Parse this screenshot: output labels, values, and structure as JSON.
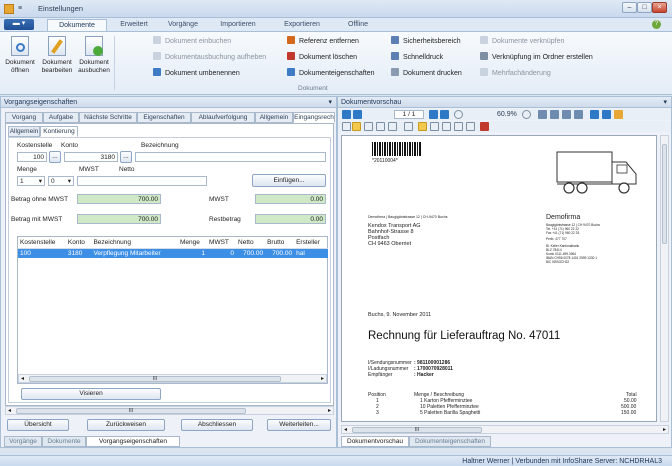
{
  "window": {
    "title": "Einstellungen",
    "min": "–",
    "max": "□",
    "close": "×"
  },
  "ribbon": {
    "file_button": "▬ ▾",
    "tabs": [
      "Dokumente",
      "Erweitert",
      "Vorgänge",
      "Importieren",
      "Exportieren",
      "Offline"
    ],
    "help": "?",
    "big": [
      {
        "label": "Dokument öffnen"
      },
      {
        "label": "Dokument bearbeiten"
      },
      {
        "label": "Dokument ausbuchen"
      }
    ],
    "col1": [
      "Dokument einbuchen",
      "Dokumentausbuchung aufheben",
      "Dokument umbenennen"
    ],
    "col2": [
      "Referenz entfernen",
      "Dokument löschen",
      "Dokumenteigenschaften"
    ],
    "col3": [
      "Sicherheitsbereich",
      "Schnelldruck",
      "Dokument drucken"
    ],
    "col4": [
      "Dokumente verknüpfen",
      "Verknüpfung im Ordner erstellen",
      "Mehrfachänderung"
    ],
    "group_label": "Dokument"
  },
  "left": {
    "header": "Vorgangseigenschaften",
    "tabs": [
      "Vorgang",
      "Aufgabe",
      "Nächste Schritte",
      "Eigenschaften",
      "Ablaufverfolgung",
      "Allgemein",
      "Eingangsrech"
    ],
    "subtabs": [
      "Allgemein",
      "Kontierung"
    ],
    "labels": {
      "kostenstelle": "Kostenstelle",
      "konto": "Konto",
      "bezeichnung": "Bezeichnung",
      "menge": "Menge",
      "mwst": "MWST",
      "netto": "Netto",
      "betrag_ohne": "Betrag ohne MWST",
      "mwst2": "MWST",
      "betrag_mit": "Betrag mit MWST",
      "restbetrag": "Restbetrag"
    },
    "values": {
      "kostenstelle": "100",
      "konto": "3180",
      "bezeichnung": "",
      "menge": "1",
      "mwst": "0",
      "netto": "",
      "betrag_ohne": "700.00",
      "mwst2": "0.00",
      "betrag_mit": "700.00",
      "restbetrag": "0.00"
    },
    "dots": "...",
    "einfuegen": "Einfügen...",
    "table": {
      "columns": [
        "Kostenstelle",
        "Konto",
        "Bezeichnung",
        "Menge",
        "MWST",
        "Netto",
        "Brutto",
        "Ersteller"
      ],
      "rows": [
        [
          "100",
          "3180",
          "Verpflegung Mitarbeiter",
          "1",
          "0",
          "700.00",
          "700.00",
          "hal"
        ]
      ]
    },
    "scroll_mid": "III",
    "visieren": "Visieren",
    "buttons": [
      "Übersicht",
      "Zurückweisen",
      "Abschliessen",
      "Weiterleiten..."
    ],
    "bottom_tabs": [
      "Vorgänge",
      "Dokumente",
      "Vorgangseigenschaften"
    ]
  },
  "right": {
    "header": "Dokumentvorschau",
    "page_field": "1 / 1",
    "zoom": "60.9%",
    "doc": {
      "barcode_text": "*20110004*",
      "sender_line": "Demofirma | Baugigäntstrasse 12 | CH-9470 Buchs",
      "address": [
        "Kendox Transport AG",
        "Bahnhof-Strasse 8",
        "Postfach",
        "CH 9463 Oberriet"
      ],
      "company": "Demofirma",
      "company_lines": [
        "Baugigäntstrasse 12 | CH 9470 Buchs",
        "Tel. +41 (71) 960 22 22",
        "Fax +41 (71) 960 22 25",
        "Perib. 477 707",
        "Bl. Keller Kantonalbank",
        "BLZ 78414",
        "Konto 0111.499.3964",
        "IBAN CH96 0078 1401 2599 1330 1",
        "BIC KBSGCH22"
      ],
      "date_line": "Buchs, 9. November 2011",
      "title": "Rechnung für Lieferauftrag No. 47011",
      "refs": [
        [
          "I/Sendungsnummer",
          ": 981100001286"
        ],
        [
          "I/Ladungsnummer",
          ": 1700070928011"
        ],
        [
          "Empfänger",
          ": Hacker"
        ]
      ],
      "items_head": [
        "Position",
        "Menge / Beschreibung",
        "Total"
      ],
      "items": [
        [
          "1",
          "1 Karton Pfefferminztee",
          "50.00"
        ],
        [
          "2",
          "10 Paletten Pfefferminztee",
          "500.00"
        ],
        [
          "3",
          "5 Paletten Barilla Spaghetti",
          "150.00"
        ]
      ]
    },
    "scroll_mid": "III",
    "bottom_tabs": [
      "Dokumentvorschau",
      "Dokumenteigenschaften"
    ]
  },
  "status": "Haltner Werner | Verbunden mit InfoShare Server: NCHDRHAL3",
  "colors": {
    "accent": "#3d8fe6",
    "ribbon_tab_active": "#f7fafd",
    "green_field": "#cfe8c6"
  }
}
